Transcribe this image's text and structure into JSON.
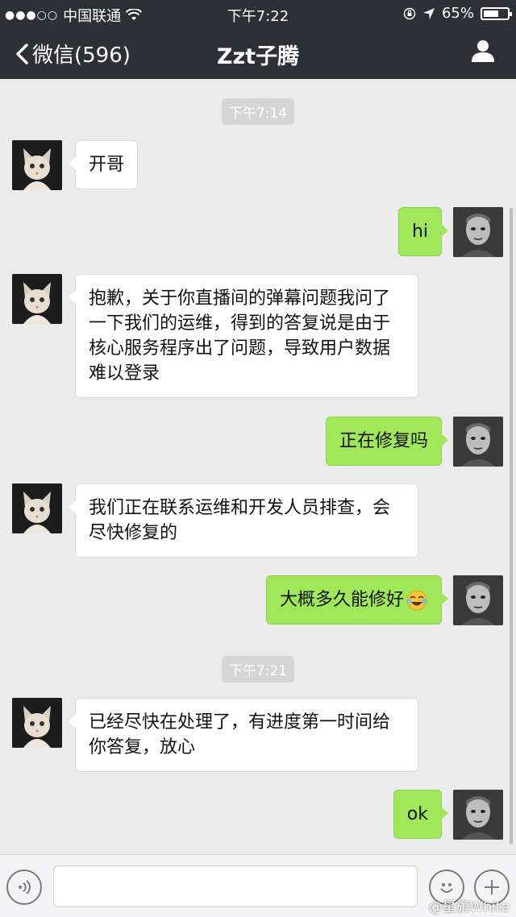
{
  "status_bar": {
    "signal_dots": "●●●○○",
    "carrier": "中国联通",
    "time": "下午7:22",
    "battery": "65%",
    "battery_level": 0.65
  },
  "nav": {
    "back_label": "微信(596)",
    "title": "Zzt子腾"
  },
  "timestamps": [
    "下午7:14",
    "下午7:21"
  ],
  "messages": [
    {
      "sender": "other",
      "text": "开哥"
    },
    {
      "sender": "me",
      "text": "hi"
    },
    {
      "sender": "other",
      "text": "抱歉，关于你直播间的弹幕问题我问了一下我们的运维，得到的答复说是由于核心服务程序出了问题，导致用户数据难以登录"
    },
    {
      "sender": "me",
      "text": "正在修复吗"
    },
    {
      "sender": "other",
      "text": "我们正在联系运维和开发人员排查，会尽快修复的"
    },
    {
      "sender": "me",
      "text": "大概多久能修好",
      "emoji": "cry-laugh-icon"
    },
    {
      "sender": "other",
      "text": "已经尽快在处理了，有进度第一时间给你答复，放心"
    },
    {
      "sender": "me",
      "text": "ok"
    }
  ],
  "input_bar": {
    "placeholder": "",
    "watermark": "@星旗White"
  },
  "colors": {
    "nav_bg": "#2e3035",
    "chat_bg": "#ebebeb",
    "my_bubble": "#a0e759",
    "other_bubble": "#ffffff"
  }
}
